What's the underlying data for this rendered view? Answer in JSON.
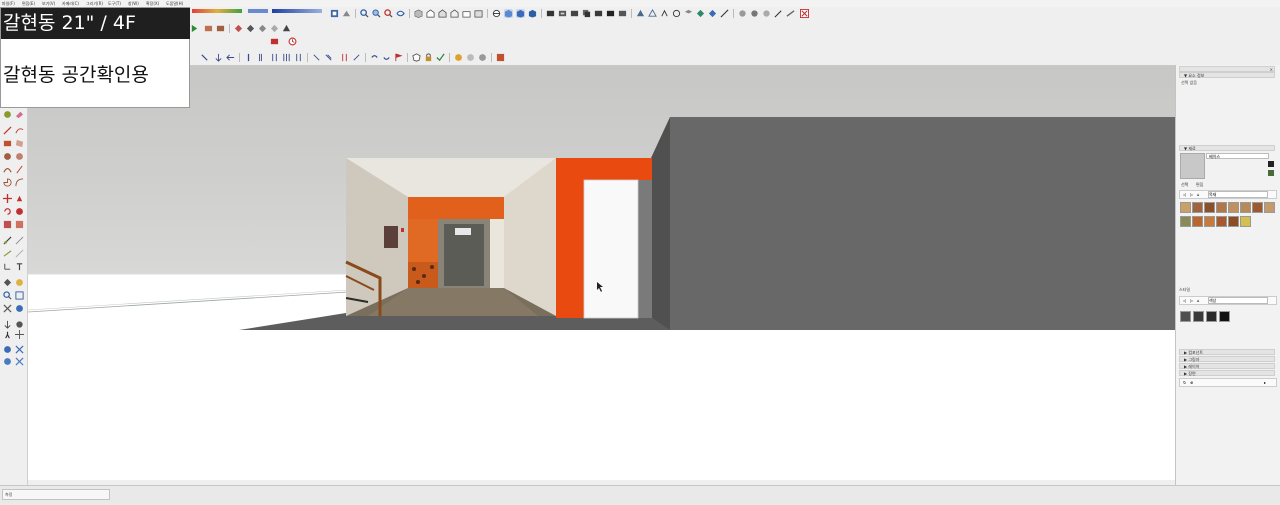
{
  "menu": {
    "items": [
      "파일(F)",
      "편집(E)",
      "보기(V)",
      "카메라(C)",
      "그리기(R)",
      "도구(T)",
      "창(W)",
      "확장(X)",
      "도움말(H)"
    ]
  },
  "overlay": {
    "title": "갈현동 21\" / 4F",
    "subtitle": "갈현동 공간확인용"
  },
  "tray": {
    "panel_info_header": "▼ 요소 정보",
    "panel_info_text": "선택 없음",
    "panel_materials_header": "▼ 재료",
    "material_name": "베이스",
    "tab_select": "선택",
    "tab_edit": "편집",
    "material_library": "목재",
    "panel_styles_header": "스타일",
    "style_library": "색상",
    "collapsed_panels": [
      "▶ 컴포넌트",
      "▶ 그림자",
      "▶ 레이어",
      "▶ 장면"
    ]
  },
  "status": {
    "text": "측정"
  },
  "colors": {
    "sky": "#c9c9c8",
    "wall": "#686868",
    "floor": "#5a5a5a",
    "accent_orange": "#e84a10",
    "toolbar_bg": "#efefef"
  },
  "swatches": {
    "wood_row1": [
      "#c8a068",
      "#a0643c",
      "#8c5028",
      "#b07848",
      "#c09060",
      "#b88a58",
      "#9a5a30",
      "#c49a6a"
    ],
    "wood_row2": [
      "#8a8a58",
      "#b8682c",
      "#c87a3c",
      "#a8582c",
      "#8c4c24",
      "#d2c050"
    ],
    "style_row": [
      "#505050",
      "#3a3a3a",
      "#2a2a2a",
      "#111111"
    ]
  }
}
